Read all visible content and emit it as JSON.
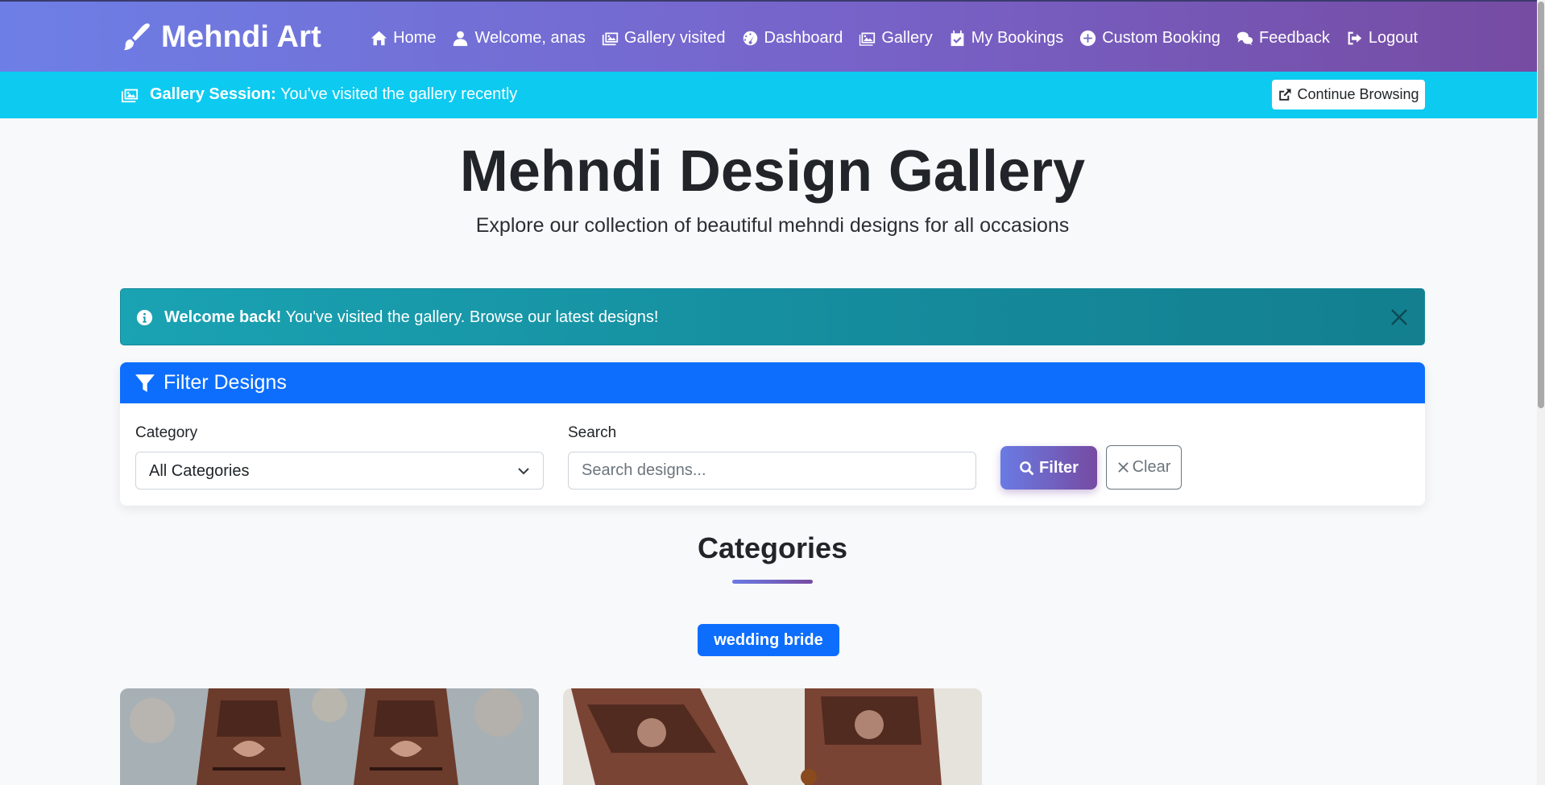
{
  "navbar": {
    "brand": "Mehndi Art",
    "links": [
      {
        "label": "Home",
        "icon": "home-icon"
      },
      {
        "label": "Welcome, anas",
        "icon": "user-icon"
      },
      {
        "label": "Gallery visited",
        "icon": "images-icon"
      },
      {
        "label": "Dashboard",
        "icon": "gauge-icon"
      },
      {
        "label": "Gallery",
        "icon": "image-icon"
      },
      {
        "label": "My Bookings",
        "icon": "calendar-check-icon"
      },
      {
        "label": "Custom Booking",
        "icon": "plus-circle-icon"
      },
      {
        "label": "Feedback",
        "icon": "comments-icon"
      },
      {
        "label": "Logout",
        "icon": "logout-icon"
      }
    ]
  },
  "session_bar": {
    "label": "Gallery Session:",
    "text": "You've visited the gallery recently",
    "button": "Continue Browsing"
  },
  "header": {
    "title": "Mehndi Design Gallery",
    "subtitle": "Explore our collection of beautiful mehndi designs for all occasions"
  },
  "alert": {
    "strong": "Welcome back!",
    "text": "You've visited the gallery. Browse our latest designs!"
  },
  "filter": {
    "title": "Filter Designs",
    "category_label": "Category",
    "category_value": "All Categories",
    "search_label": "Search",
    "search_placeholder": "Search designs...",
    "filter_button": "Filter",
    "clear_button": "Clear"
  },
  "categories": {
    "title": "Categories",
    "items": [
      "wedding bride"
    ]
  },
  "colors": {
    "nav_gradient_start": "#6d7fe6",
    "nav_gradient_end": "#764ba2",
    "session_bar": "#0dcaf0",
    "alert": "#168fa0",
    "primary": "#0d6efd"
  }
}
